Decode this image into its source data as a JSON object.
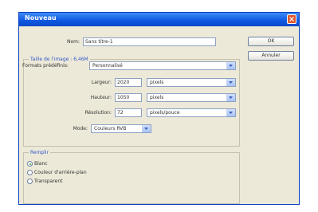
{
  "dialog": {
    "title": "Nouveau",
    "name_label": "Nom:",
    "name_value": "Sans titre-1",
    "ok_label": "OK",
    "cancel_label": "Annuler",
    "image_size_legend": "Taille de l'image : 6,46M",
    "preset_label": "Formats prédéfinis:",
    "preset_value": "Personnalisé",
    "width_label": "Largeur:",
    "width_value": "2020",
    "width_unit": "pixels",
    "height_label": "Hauteur:",
    "height_value": "1050",
    "height_unit": "pixels",
    "resolution_label": "Résolution:",
    "resolution_value": "72",
    "resolution_unit": "pixels/pouce",
    "mode_label": "Mode:",
    "mode_value": "Couleurs RVB",
    "fill_legend": "Remplir",
    "fill_options": [
      {
        "label": "Blanc",
        "selected": true
      },
      {
        "label": "Couleur d'arrière-plan",
        "selected": false
      },
      {
        "label": "Transparent",
        "selected": false
      }
    ]
  }
}
